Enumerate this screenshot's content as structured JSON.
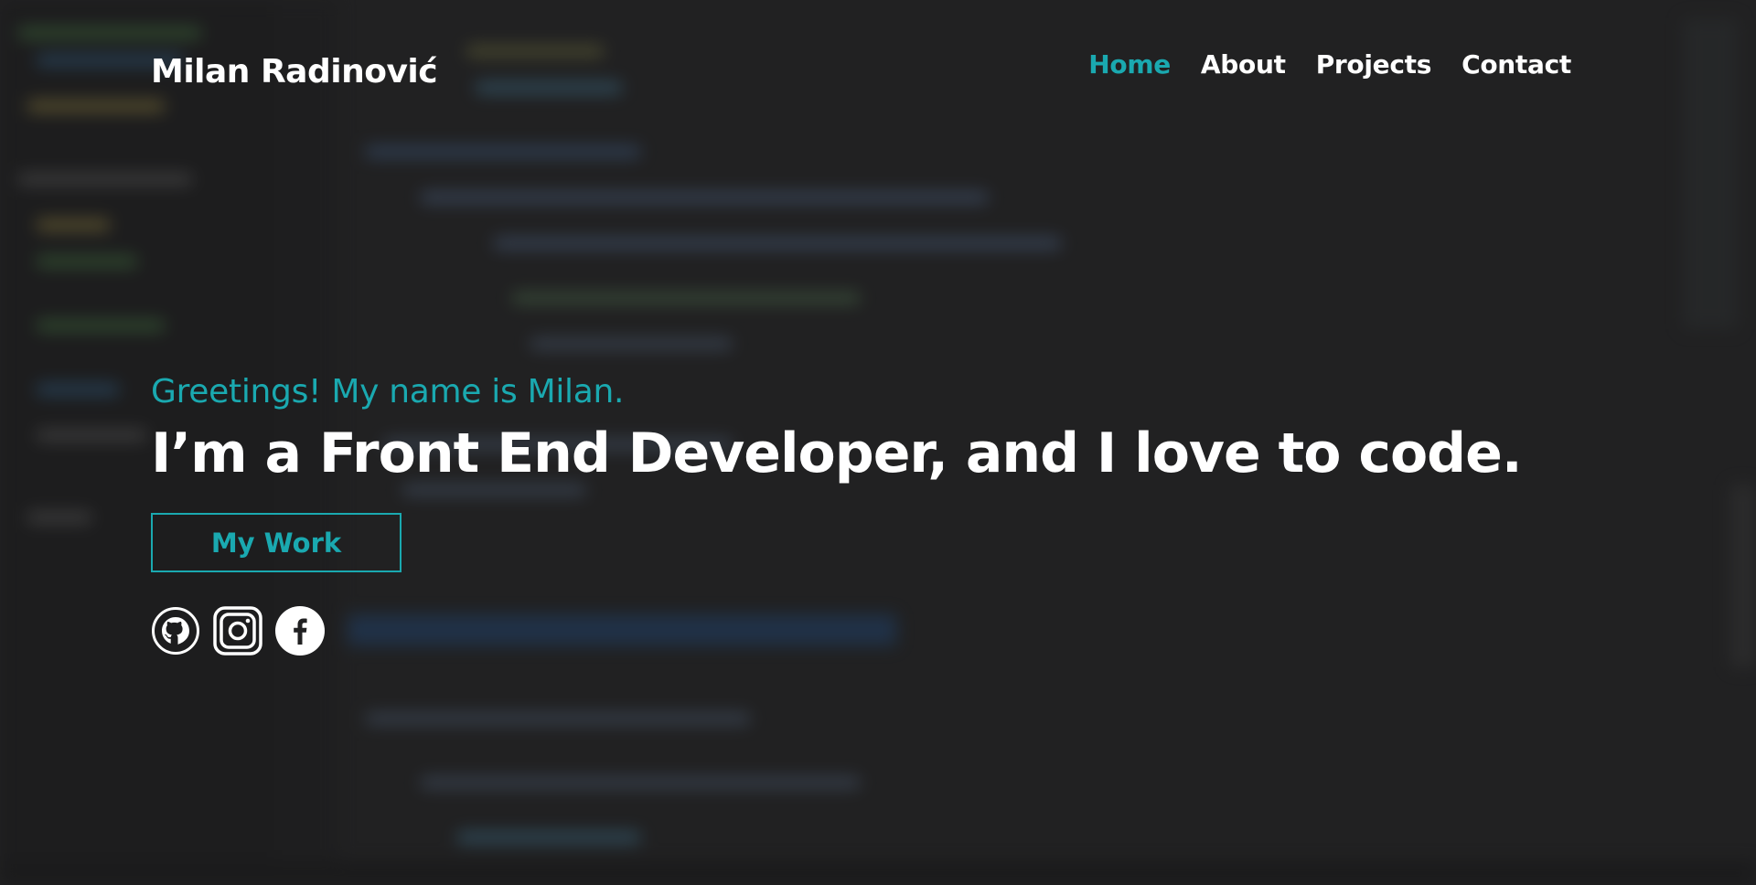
{
  "brand": "Milan Radinović",
  "nav": {
    "items": [
      {
        "label": "Home",
        "active": true
      },
      {
        "label": "About",
        "active": false
      },
      {
        "label": "Projects",
        "active": false
      },
      {
        "label": "Contact",
        "active": false
      }
    ]
  },
  "hero": {
    "greeting": "Greetings! My name is Milan.",
    "headline": "I’m a Front End Developer, and I love to code.",
    "cta_label": "My Work"
  },
  "socials": [
    {
      "icon": "github-icon"
    },
    {
      "icon": "instagram-icon"
    },
    {
      "icon": "facebook-icon"
    }
  ],
  "colors": {
    "accent": "#1aa9b0",
    "text": "#ffffff",
    "background": "#212122"
  }
}
